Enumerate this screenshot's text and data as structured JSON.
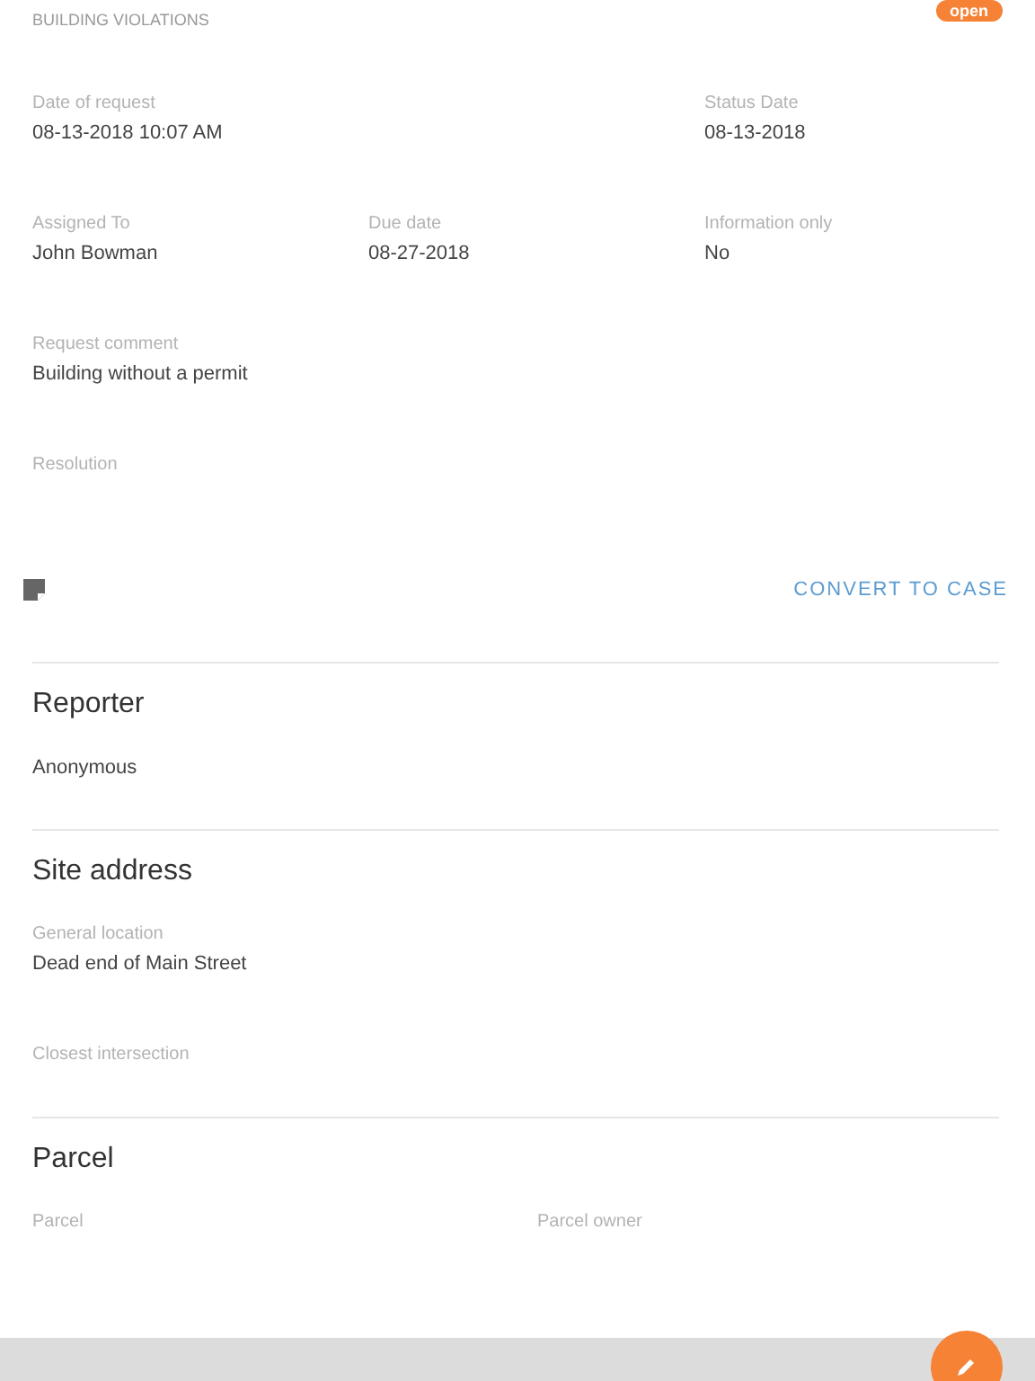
{
  "header": {
    "category": "BUILDING VIOLATIONS",
    "status_badge": "open"
  },
  "details": {
    "rows": [
      {
        "fields": [
          {
            "label": "Date of request",
            "value": "08-13-2018 10:07 AM"
          },
          {
            "label": "Status Date",
            "value": "08-13-2018"
          }
        ]
      },
      {
        "fields": [
          {
            "label": "Assigned To",
            "value": "John Bowman"
          },
          {
            "label": "Due date",
            "value": "08-27-2018"
          },
          {
            "label": "Information only",
            "value": "No"
          }
        ]
      },
      {
        "fields": [
          {
            "label": "Request comment",
            "value": "Building without a permit"
          }
        ]
      },
      {
        "fields": [
          {
            "label": "Resolution"
          }
        ]
      }
    ],
    "action": "CONVERT TO CASE"
  },
  "sections": [
    {
      "title": "Reporter",
      "rows": [
        {
          "fields": [
            {
              "value": "Anonymous"
            }
          ]
        }
      ]
    },
    {
      "title": "Site address",
      "rows": [
        {
          "fields": [
            {
              "label": "General location",
              "value": "Dead end of Main Street"
            }
          ]
        },
        {
          "fields": [
            {
              "label": "Closest intersection"
            }
          ]
        }
      ]
    },
    {
      "title": "Parcel",
      "rows": [
        {
          "fields": [
            {
              "label": "Parcel"
            },
            {
              "label": "Parcel owner"
            }
          ]
        }
      ]
    }
  ]
}
